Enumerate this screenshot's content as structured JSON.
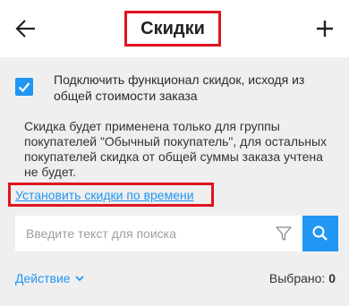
{
  "header": {
    "title": "Скидки",
    "back_icon": "arrow-left-icon",
    "add_icon": "plus-icon"
  },
  "option": {
    "checked": true,
    "label": "Подключить функционал скидок, исходя из общей стоимости заказа"
  },
  "note": "Скидка будет применена только для группы покупателей \"Обычный покупатель\", для остальных покупателей скидка от общей суммы заказа учтена не будет.",
  "time_link": "Установить скидки по времени",
  "search": {
    "placeholder": "Введите текст для поиска",
    "value": ""
  },
  "footer": {
    "action_label": "Действие",
    "selected_label": "Выбрано:",
    "selected_count": "0"
  },
  "colors": {
    "accent": "#2196f3",
    "highlight": "#e0141e",
    "background": "#efefef"
  }
}
